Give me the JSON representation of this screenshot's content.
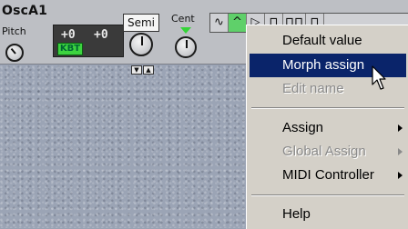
{
  "module": {
    "title": "OscA1",
    "pitch_label": "Pitch",
    "display_left": "+0",
    "display_right": "+0",
    "kbt_label": "KBT",
    "semi_label": "Semi",
    "cent_label": "Cent",
    "waveforms": [
      "∿",
      "^",
      "▷",
      "⊓",
      "⊓⊓",
      "⊓"
    ]
  },
  "context_menu": {
    "items": [
      {
        "label": "Default value",
        "state": "normal",
        "submenu": false
      },
      {
        "label": "Morph assign",
        "state": "selected",
        "submenu": false
      },
      {
        "label": "Edit name",
        "state": "disabled",
        "submenu": false
      },
      {
        "label": "Assign",
        "state": "normal",
        "submenu": true
      },
      {
        "label": "Global Assign",
        "state": "disabled",
        "submenu": true
      },
      {
        "label": "MIDI Controller",
        "state": "normal",
        "submenu": true
      },
      {
        "label": "Help",
        "state": "normal",
        "submenu": false
      }
    ]
  },
  "colors": {
    "menu_highlight": "#0a246a",
    "menu_bg": "#d4d0c8",
    "kbt_green": "#3dd33f",
    "panel_texture": "#9ba4b5"
  }
}
